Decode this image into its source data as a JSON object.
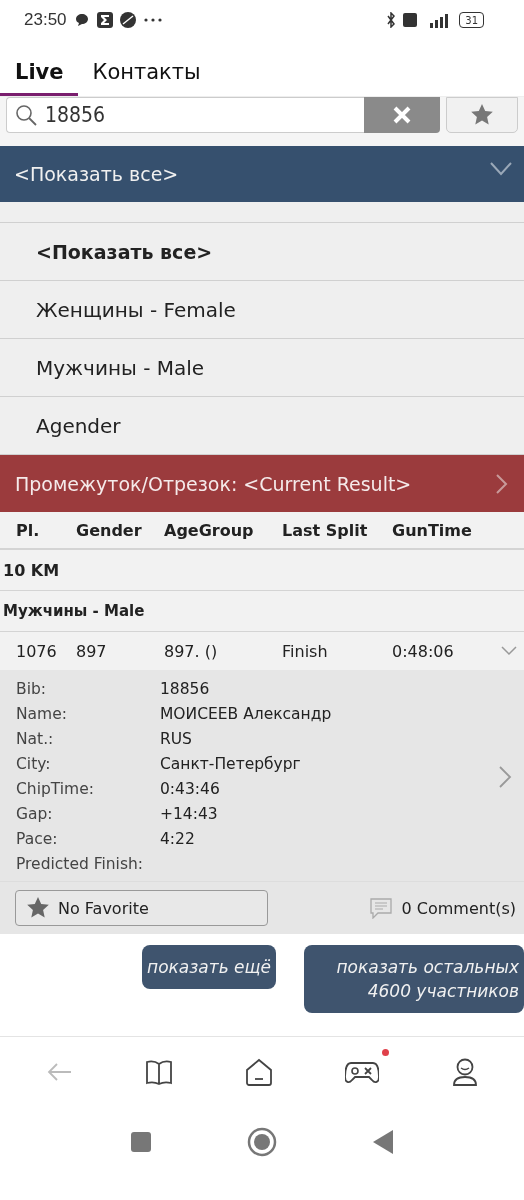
{
  "status_bar": {
    "time": "23:50",
    "battery": "31"
  },
  "tabs": [
    {
      "label": "Live",
      "selected": true
    },
    {
      "label": "Контакты",
      "selected": false
    }
  ],
  "search": {
    "value": "18856"
  },
  "filter": {
    "label": "<Показать все>",
    "expanded": true
  },
  "filter_options": [
    {
      "label": "<Показать все>",
      "selected": true
    },
    {
      "label": "Женщины - Female",
      "selected": false
    },
    {
      "label": "Мужчины - Male",
      "selected": false
    },
    {
      "label": "Agender",
      "selected": false
    }
  ],
  "split": {
    "label": "Промежуток/Отрезок: <Current Result>"
  },
  "table": {
    "columns": [
      "Pl.",
      "Gender",
      "AgeGroup",
      "Last Split",
      "GunTime"
    ],
    "groups": [
      "10 KM",
      "Мужчины - Male"
    ],
    "row": {
      "cells": [
        "1076",
        "897",
        "897. ()",
        "Finish",
        "0:48:06"
      ],
      "expanded": true
    },
    "details": [
      {
        "label": "Bib:",
        "value": "18856"
      },
      {
        "label": "Name:",
        "value": "МОИСЕЕВ Александр"
      },
      {
        "label": "Nat.:",
        "value": "RUS"
      },
      {
        "label": "City:",
        "value": "Санкт-Петербург"
      },
      {
        "label": "ChipTime:",
        "value": "0:43:46"
      },
      {
        "label": "Gap:",
        "value": "+14:43"
      },
      {
        "label": "Pace:",
        "value": "4:22"
      },
      {
        "label": "Predicted Finish:"
      }
    ],
    "favorite": "No Favorite",
    "comments": "0 Comment(s)"
  },
  "buttons": [
    "показать ещё",
    "показать остальных 4600 участников"
  ],
  "bottom_nav": {
    "game_badge": true
  }
}
